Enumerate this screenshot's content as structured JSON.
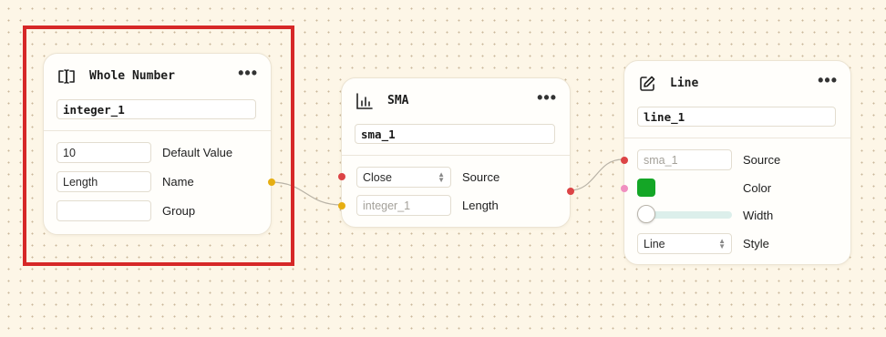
{
  "colors": {
    "selection": "#d62828",
    "port_yellow": "#e6ae12",
    "port_red": "#dc4446",
    "port_pink": "#f08fc0",
    "line_color": "#14a626",
    "edge": "#b8b2a6"
  },
  "nodes": {
    "whole_number": {
      "icon": "input-cursor-icon",
      "title": "Whole Number",
      "menu": "•••",
      "name_value": "integer_1",
      "default_value": "10",
      "default_value_label": "Default Value",
      "name_field": "Length",
      "name_label": "Name",
      "group_value": "",
      "group_label": "Group"
    },
    "sma": {
      "icon": "bar-chart-icon",
      "title": "SMA",
      "menu": "•••",
      "name_value": "sma_1",
      "source_value": "Close",
      "source_label": "Source",
      "length_value": "integer_1",
      "length_label": "Length"
    },
    "line": {
      "icon": "edit-square-icon",
      "title": "Line",
      "menu": "•••",
      "name_value": "line_1",
      "source_value": "sma_1",
      "source_label": "Source",
      "color_label": "Color",
      "width_label": "Width",
      "width_level": 0,
      "style_value": "Line",
      "style_label": "Style"
    }
  }
}
